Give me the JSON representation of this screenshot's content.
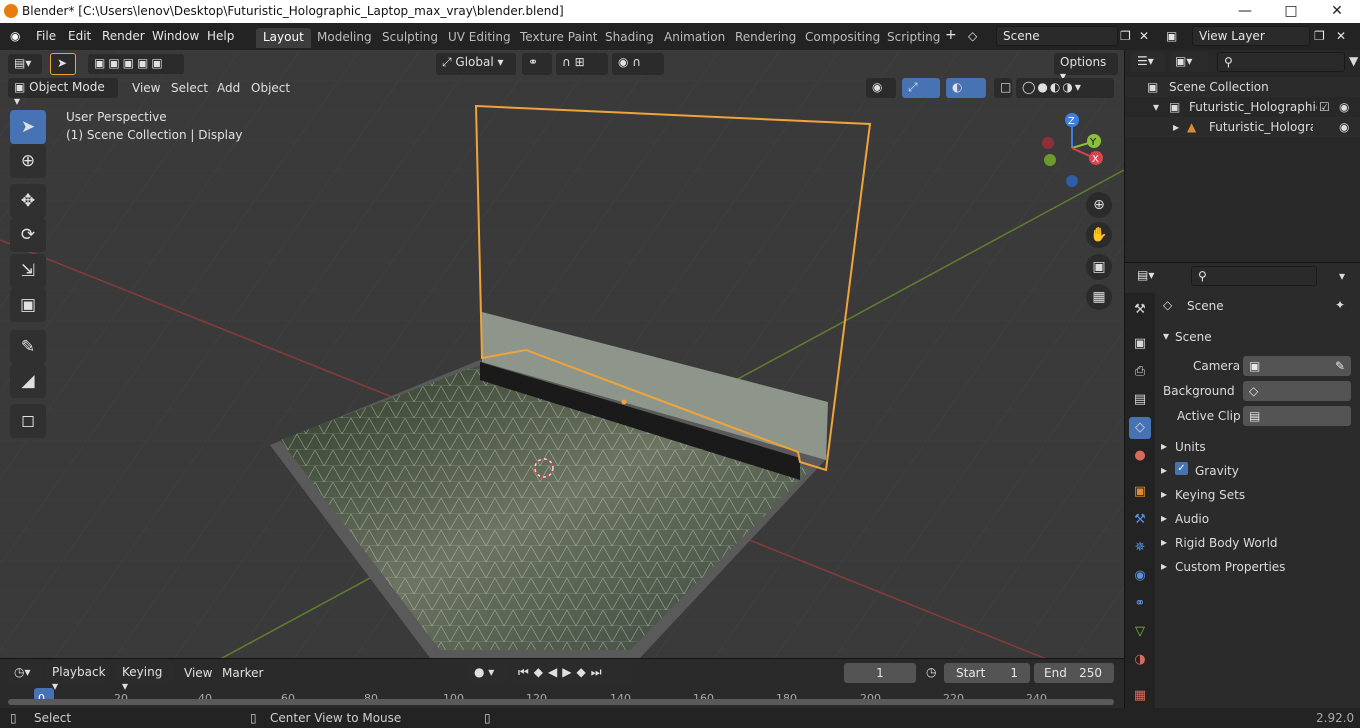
{
  "window": {
    "title": "Blender* [C:\\Users\\lenov\\Desktop\\Futuristic_Holographic_Laptop_max_vray\\blender.blend]"
  },
  "menu": [
    "File",
    "Edit",
    "Render",
    "Window",
    "Help"
  ],
  "workspaces": [
    "Layout",
    "Modeling",
    "Sculpting",
    "UV Editing",
    "Texture Paint",
    "Shading",
    "Animation",
    "Rendering",
    "Compositing",
    "Scripting"
  ],
  "scene_field": "Scene",
  "view_layer_field": "View Layer",
  "viewport": {
    "transform_orientation": "Global",
    "options": "Options",
    "mode": "Object Mode",
    "menus": [
      "View",
      "Select",
      "Add",
      "Object"
    ],
    "info_line1": "User Perspective",
    "info_line2": "(1) Scene Collection | Display",
    "gizmo": {
      "x": "X",
      "y": "Y",
      "z": "Z"
    }
  },
  "outliner": {
    "root": "Scene Collection",
    "collection": "Futuristic_Holographic_L",
    "object": "Futuristic_Holograph"
  },
  "properties": {
    "context": "Scene",
    "panel": "Scene",
    "camera_label": "Camera",
    "background_label": "Background ...",
    "active_clip_label": "Active Clip",
    "subpanels": [
      "Units",
      "Gravity",
      "Keying Sets",
      "Audio",
      "Rigid Body World",
      "Custom Properties"
    ],
    "gravity_checked": true
  },
  "timeline": {
    "menus": [
      "Playback",
      "Keying",
      "View",
      "Marker"
    ],
    "current_frame": "1",
    "start_label": "Start",
    "start": "1",
    "end_label": "End",
    "end": "250",
    "ruler": [
      "0",
      "20",
      "40",
      "60",
      "80",
      "100",
      "120",
      "140",
      "160",
      "180",
      "200",
      "220",
      "240"
    ]
  },
  "status": {
    "left": "Select",
    "middle": "Center View to Mouse",
    "version": "2.92.0"
  },
  "colors": {
    "accent": "#4772b3",
    "selection": "#f0a33a",
    "x_axis": "#d5454f",
    "y_axis": "#8bbf3c",
    "z_axis": "#3d7fe0"
  }
}
